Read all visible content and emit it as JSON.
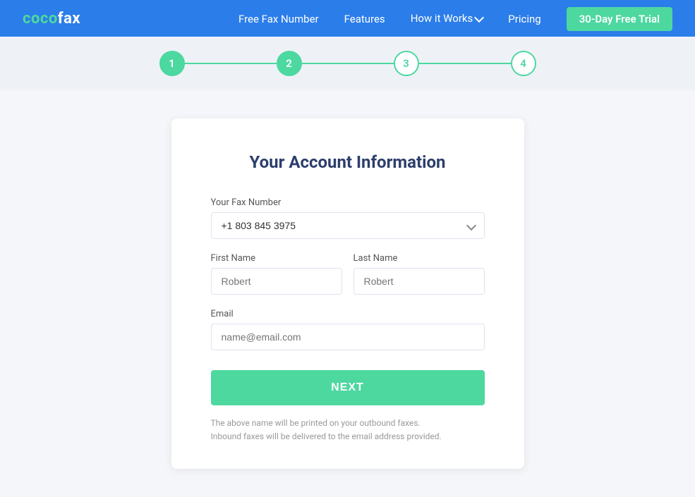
{
  "nav": {
    "logo_prefix": "coco",
    "logo_suffix": "fax",
    "links": [
      {
        "label": "Free Fax Number",
        "id": "free-fax-number"
      },
      {
        "label": "Features",
        "id": "features"
      },
      {
        "label": "How it Works",
        "id": "how-it-works"
      },
      {
        "label": "Pricing",
        "id": "pricing"
      }
    ],
    "cta_label": "30-Day Free Trial"
  },
  "stepper": {
    "steps": [
      {
        "number": "1",
        "state": "active"
      },
      {
        "number": "2",
        "state": "active"
      },
      {
        "number": "3",
        "state": "inactive"
      },
      {
        "number": "4",
        "state": "inactive"
      }
    ]
  },
  "form": {
    "title": "Your Account Information",
    "fax_number_label": "Your Fax Number",
    "fax_number_value": "+1 803 845 3975",
    "first_name_label": "First Name",
    "first_name_placeholder": "Robert",
    "last_name_label": "Last Name",
    "last_name_placeholder": "Robert",
    "email_label": "Email",
    "email_placeholder": "name@email.com",
    "next_button_label": "NEXT",
    "note_line1": "The above name will be printed on your outbound faxes.",
    "note_line2": "Inbound faxes will be delivered to the email address provided."
  }
}
